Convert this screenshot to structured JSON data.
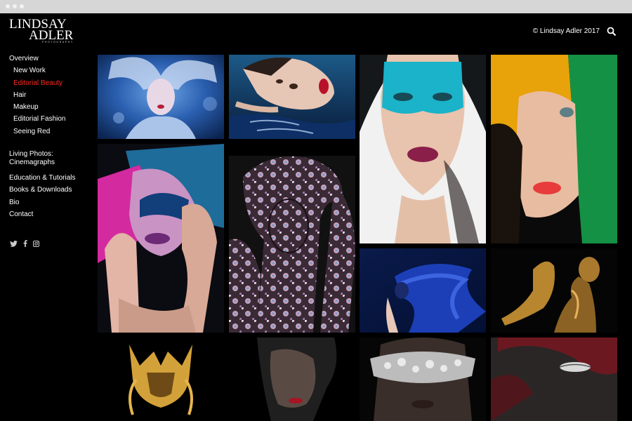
{
  "logo": {
    "line1": "LINDSAY",
    "line2": "ADLER",
    "line3": "PHOTOGRAPHY"
  },
  "header": {
    "copyright": "© Lindsay Adler 2017",
    "search_icon": "search-icon"
  },
  "nav": {
    "items": [
      {
        "label": "Overview"
      },
      {
        "label": "New Work"
      },
      {
        "label": "Editorial Beauty"
      },
      {
        "label": "Hair"
      },
      {
        "label": "Makeup"
      },
      {
        "label": "Editorial Fashion"
      },
      {
        "label": "Seeing Red"
      },
      {
        "label": "Living Photos: Cinemagraphs"
      },
      {
        "label": "Education & Tutorials"
      },
      {
        "label": "Books & Downloads"
      },
      {
        "label": "Bio"
      },
      {
        "label": "Contact"
      }
    ],
    "active_color": "#ff2a20"
  },
  "social": {
    "icons": [
      "twitter-icon",
      "facebook-icon",
      "instagram-icon"
    ]
  }
}
